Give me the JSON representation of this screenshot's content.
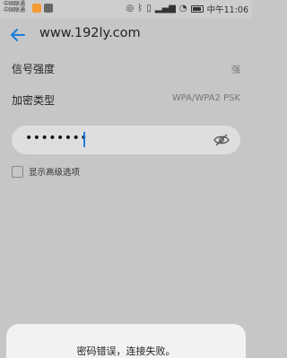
{
  "status_bar": {
    "carrier_1": "中国联通",
    "carrier_2": "中国联通",
    "time_prefix": "中午",
    "time": "11:06",
    "battery_level": 0.7
  },
  "header": {
    "title": "www.192ly.com"
  },
  "details": {
    "signal_label": "信号强度",
    "signal_value": "强",
    "encryption_label": "加密类型",
    "encryption_value": "WPA/WPA2 PSK"
  },
  "password": {
    "value": "••••••••"
  },
  "advanced": {
    "label": "显示高级选项"
  },
  "toast": {
    "message": "密码错误，连接失败。"
  },
  "colors": {
    "accent": "#1b7cde",
    "background": "#c6c6c6"
  }
}
